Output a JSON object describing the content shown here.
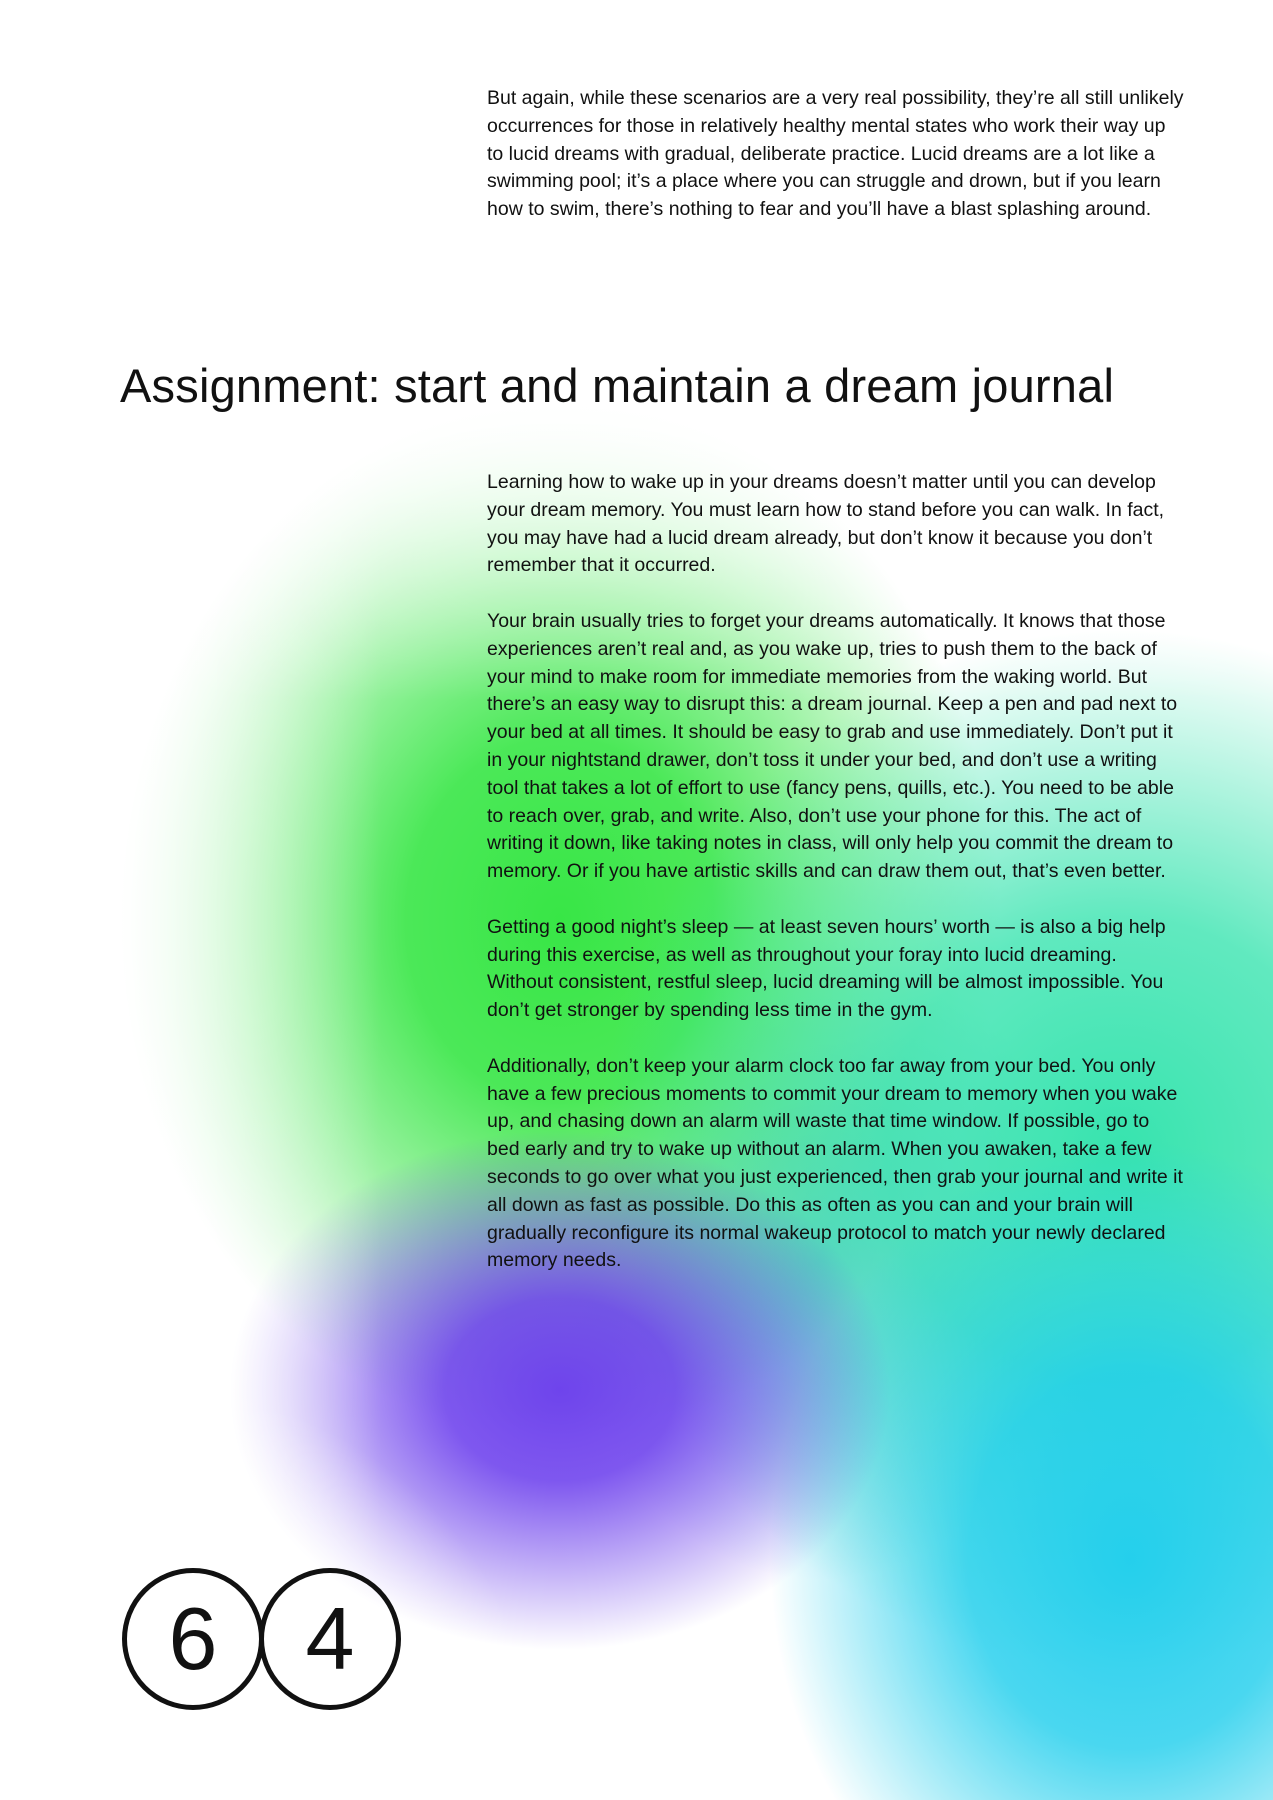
{
  "intro_paragraph": "But again, while these scenarios are a very real possibility, they’re all still unlikely occurrences for those in relatively healthy mental states who work their way up to lucid dreams with gradual, deliberate practice. Lucid dreams are a lot like a swimming pool; it’s a place where you can struggle and drown, but if you learn how to swim, there’s nothing to fear and you’ll have a blast splashing around.",
  "heading": "Assignment: start and maintain a dream journal",
  "paragraphs": [
    "Learning how to wake up in your dreams doesn’t matter until you can develop your dream memory. You must learn how to stand before you can walk. In fact, you may have had a lucid dream already, but don’t know it because you don’t remember that it occurred.",
    "Your brain usually tries to forget your dreams automatically. It knows that those experiences aren’t real and, as you wake up, tries to push them to the back of your mind to make room for immediate memories from the waking world. But there’s an easy way to disrupt this: a dream journal. Keep a pen and pad next to your bed at all times. It should be easy to grab and use immediately. Don’t put it in your nightstand drawer, don’t toss it under your bed, and don’t use a writing tool that takes a lot of effort to use (fancy pens, quills, etc.). You need to be able to reach over, grab, and write. Also, don’t use your phone for this. The act of writing it down, like taking notes in class, will only help you commit the dream to memory. Or if you have artistic skills and can draw them out, that’s even better.",
    "Getting a good night’s sleep — at least seven hours’ worth — is also a big help during this exercise, as well as throughout your foray into lucid dreaming. Without consistent, restful sleep, lucid dreaming will be almost impossible. You don’t get stronger by spending less time in the gym.",
    "Additionally, don’t keep your alarm clock too far away from your bed. You only have a few precious moments to commit your dream to memory when you wake up, and chasing down an alarm will waste that time window. If possible, go to bed early and try to wake up without an alarm. When you awaken, take a few seconds to go over what you just experienced, then grab your journal and write it all down as fast as possible. Do this as often as you can and your brain will gradually reconfigure its normal wakeup protocol to match your newly declared memory needs."
  ],
  "page_number": {
    "digit_1": "6",
    "digit_2": "4"
  },
  "colors": {
    "text": "#111111",
    "green": "#38e646",
    "purple": "#683aec",
    "cyan": "#1ccdec",
    "mint": "#2ce2aa"
  }
}
